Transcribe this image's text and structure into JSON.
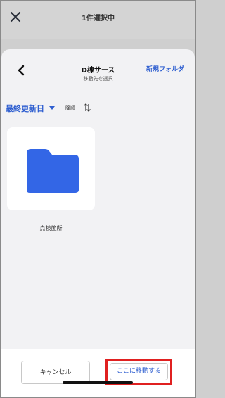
{
  "topbar": {
    "title": "1件選択中",
    "close_icon": "close-icon"
  },
  "sheet": {
    "title": "D棟サース",
    "subtitle": "移動先を選択",
    "new_folder_label": "新規フォルダ",
    "back_icon": "chevron-left-icon"
  },
  "sort": {
    "selected": "最終更新日",
    "order_label": "降順",
    "order_icon": "sort-arrows-icon"
  },
  "folders": [
    {
      "name": "点検箇所",
      "icon": "folder-icon",
      "color": "#3366e6"
    }
  ],
  "footer": {
    "cancel_label": "キャンセル",
    "move_label": "ここに移動する",
    "highlight_color": "#e02020"
  },
  "colors": {
    "accent": "#2f5fd0",
    "folder": "#3366e6"
  }
}
